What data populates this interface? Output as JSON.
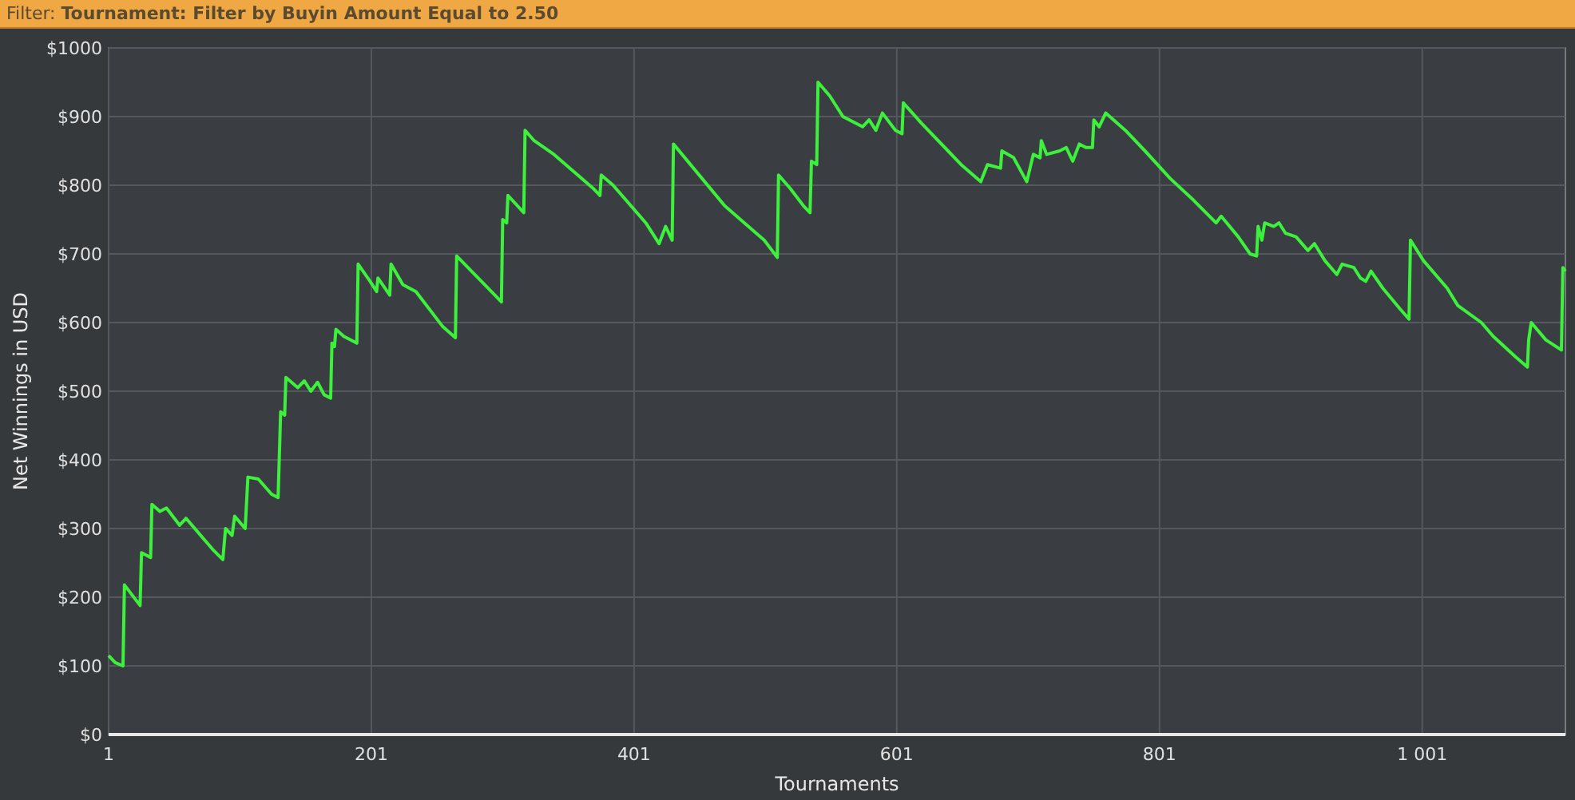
{
  "filter_bar": {
    "text": "Filter: **Tournament: Filter by Buyin Amount Equal to 2.50**"
  },
  "chart": {
    "chart_data": {
      "type": "line",
      "xlabel": "Tournaments",
      "ylabel": "Net Winnings in USD",
      "x": [
        1,
        6,
        12,
        13,
        25,
        26,
        33,
        34,
        40,
        45,
        55,
        60,
        80,
        88,
        90,
        95,
        97,
        105,
        107,
        115,
        125,
        130,
        132,
        135,
        136,
        145,
        150,
        155,
        160,
        165,
        170,
        171,
        173,
        174,
        180,
        190,
        191,
        200,
        205,
        206,
        215,
        216,
        225,
        235,
        255,
        265,
        266,
        295,
        300,
        301,
        304,
        305,
        317,
        318,
        325,
        340,
        355,
        370,
        375,
        376,
        385,
        410,
        420,
        425,
        430,
        431,
        470,
        485,
        500,
        510,
        511,
        520,
        530,
        535,
        536,
        540,
        541,
        550,
        560,
        575,
        580,
        585,
        590,
        600,
        605,
        606,
        620,
        640,
        650,
        665,
        670,
        680,
        681,
        690,
        700,
        705,
        710,
        711,
        715,
        725,
        730,
        735,
        740,
        745,
        750,
        751,
        755,
        760,
        775,
        790,
        809,
        826,
        844,
        848,
        861,
        870,
        875,
        876,
        879,
        881,
        888,
        892,
        897,
        905,
        914,
        919,
        927,
        936,
        940,
        949,
        954,
        958,
        962,
        971,
        984,
        991,
        992,
        1002,
        1020,
        1028,
        1046,
        1055,
        1072,
        1081,
        1082,
        1084,
        1095,
        1107,
        1108,
        1110
      ],
      "grid": true,
      "series": [
        {
          "color": "#3cf03c",
          "values": [
            115,
            105,
            100,
            218,
            188,
            265,
            258,
            335,
            325,
            330,
            305,
            315,
            270,
            255,
            300,
            290,
            318,
            300,
            375,
            372,
            350,
            345,
            470,
            465,
            520,
            505,
            515,
            500,
            513,
            495,
            490,
            570,
            565,
            590,
            580,
            570,
            685,
            660,
            645,
            665,
            640,
            685,
            655,
            645,
            595,
            578,
            697,
            640,
            630,
            750,
            745,
            785,
            760,
            880,
            865,
            845,
            820,
            795,
            785,
            815,
            800,
            745,
            715,
            740,
            720,
            860,
            770,
            745,
            720,
            695,
            815,
            795,
            770,
            760,
            835,
            830,
            950,
            930,
            900,
            885,
            895,
            880,
            905,
            880,
            875,
            920,
            890,
            850,
            830,
            805,
            830,
            825,
            850,
            840,
            805,
            845,
            840,
            865,
            845,
            850,
            855,
            835,
            860,
            855,
            855,
            895,
            885,
            905,
            880,
            850,
            810,
            780,
            745,
            755,
            725,
            700,
            697,
            740,
            720,
            745,
            740,
            745,
            730,
            725,
            705,
            715,
            690,
            670,
            685,
            680,
            665,
            660,
            675,
            650,
            620,
            605,
            720,
            690,
            650,
            625,
            600,
            580,
            550,
            535,
            575,
            600,
            575,
            560,
            680,
            675
          ]
        }
      ],
      "xlim": [
        1,
        1110
      ],
      "ylim": [
        0,
        1000
      ],
      "xticks": [
        {
          "value": 1,
          "label": "1"
        },
        {
          "value": 201,
          "label": "201"
        },
        {
          "value": 401,
          "label": "401"
        },
        {
          "value": 601,
          "label": "601"
        },
        {
          "value": 801,
          "label": "801"
        },
        {
          "value": 1001,
          "label": "1 001"
        }
      ],
      "yticks": [
        {
          "value": 0,
          "label": "$0"
        },
        {
          "value": 100,
          "label": "$100"
        },
        {
          "value": 200,
          "label": "$200"
        },
        {
          "value": 300,
          "label": "$300"
        },
        {
          "value": 400,
          "label": "$400"
        },
        {
          "value": 500,
          "label": "$500"
        },
        {
          "value": 600,
          "label": "$600"
        },
        {
          "value": 700,
          "label": "$700"
        },
        {
          "value": 800,
          "label": "$800"
        },
        {
          "value": 900,
          "label": "$900"
        },
        {
          "value": 1000,
          "label": "$1000"
        }
      ]
    }
  }
}
